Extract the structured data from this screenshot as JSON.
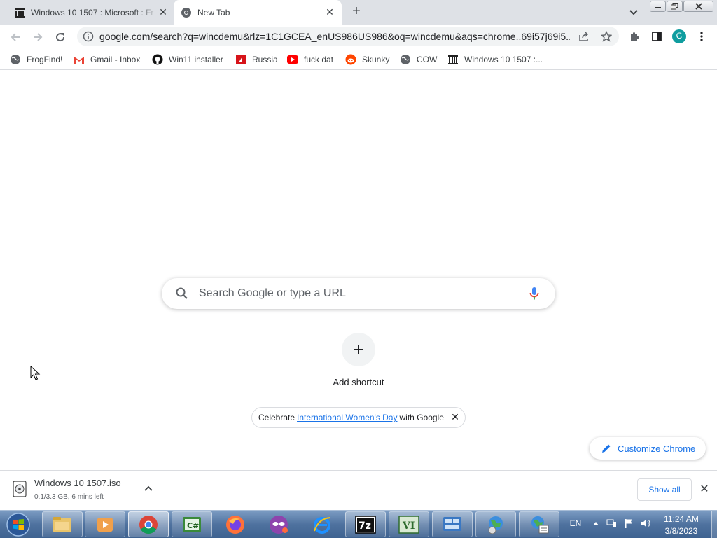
{
  "tabs": [
    {
      "title": "Windows 10 1507 : Microsoft : Fr",
      "icon": "archive-org-icon"
    },
    {
      "title": "New Tab",
      "icon": "chrome-icon"
    }
  ],
  "toolbar": {
    "url": "google.com/search?q=wincdemu&rlz=1C1GCEA_enUS986US986&oq=wincdemu&aqs=chrome..69i57j69i5...",
    "profile_initial": "C",
    "profile_color": "#0f9d9f"
  },
  "bookmarks": [
    {
      "label": "FrogFind!",
      "icon": "globe-icon"
    },
    {
      "label": "Gmail - Inbox",
      "icon": "gmail-icon"
    },
    {
      "label": "Win11 installer",
      "icon": "github-icon"
    },
    {
      "label": "Russia",
      "icon": "russia-site-icon"
    },
    {
      "label": "fuck dat",
      "icon": "youtube-icon"
    },
    {
      "label": "Skunky",
      "icon": "reddit-icon"
    },
    {
      "label": "COW",
      "icon": "globe-icon"
    },
    {
      "label": "Windows 10 1507 :...",
      "icon": "archive-org-icon"
    }
  ],
  "ntp": {
    "search_placeholder": "Search Google or type a URL",
    "add_shortcut_label": "Add shortcut",
    "promo_before": "Celebrate",
    "promo_link": "International Women's Day",
    "promo_after": "with Google",
    "customize_label": "Customize Chrome"
  },
  "download": {
    "filename": "Windows 10 1507.iso",
    "status": "0.1/3.3 GB, 6 mins left",
    "show_all": "Show all"
  },
  "taskbar": {
    "apps": [
      "explorer",
      "media-player",
      "chrome",
      "csharp-editor",
      "firefox",
      "tor-like-browser",
      "internet-explorer",
      "7zip",
      "vi-editor",
      "control-panel",
      "network-globe",
      "network-settings"
    ],
    "language": "EN",
    "time": "11:24 AM",
    "date": "3/8/2023"
  },
  "colors": {
    "accent": "#1a73e8",
    "tabstrip": "#dee1e6",
    "taskbar": "#4f729f"
  }
}
